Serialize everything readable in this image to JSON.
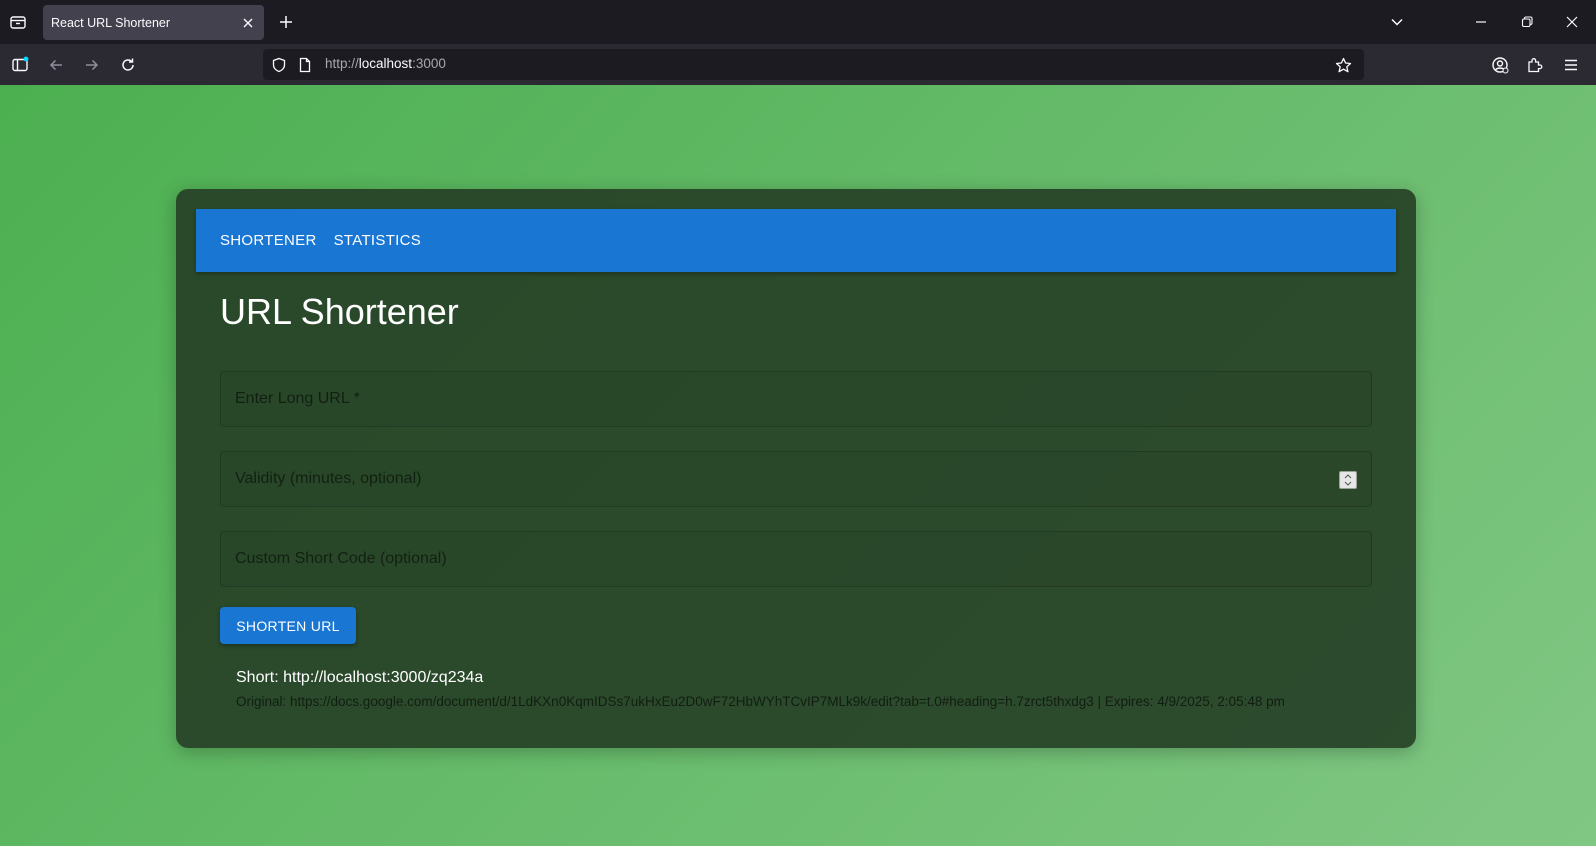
{
  "browser": {
    "tab_title": "React URL Shortener",
    "url_scheme": "http://",
    "url_host": "localhost",
    "url_port": ":3000"
  },
  "app": {
    "nav": [
      "SHORTENER",
      "STATISTICS"
    ],
    "title": "URL Shortener",
    "fields": {
      "long_url_placeholder": "Enter Long URL *",
      "long_url_value": "",
      "validity_placeholder": "Validity (minutes, optional)",
      "validity_value": "",
      "shortcode_placeholder": "Custom Short Code (optional)",
      "shortcode_value": ""
    },
    "submit_label": "SHORTEN URL",
    "result": {
      "short_line": "Short: http://localhost:3000/zq234a",
      "meta_line": "Original: https://docs.google.com/document/d/1LdKXn0KqmIDSs7ukHxEu2D0wF72HbWYhTCvIP7MLk9k/edit?tab=t.0#heading=h.7zrct5thxdg3 | Expires: 4/9/2025, 2:05:48 pm"
    }
  },
  "colors": {
    "accent": "#1976d2",
    "background_gradient_start": "#4caf50",
    "background_gradient_end": "#81c784"
  },
  "icons": [
    "tab-list-icon",
    "close-icon",
    "plus-icon",
    "chevron-down-icon",
    "minimize-icon",
    "restore-icon",
    "sidebar-icon",
    "back-arrow-icon",
    "forward-arrow-icon",
    "reload-icon",
    "shield-icon",
    "page-icon",
    "star-icon",
    "account-icon",
    "extensions-icon",
    "menu-icon"
  ]
}
